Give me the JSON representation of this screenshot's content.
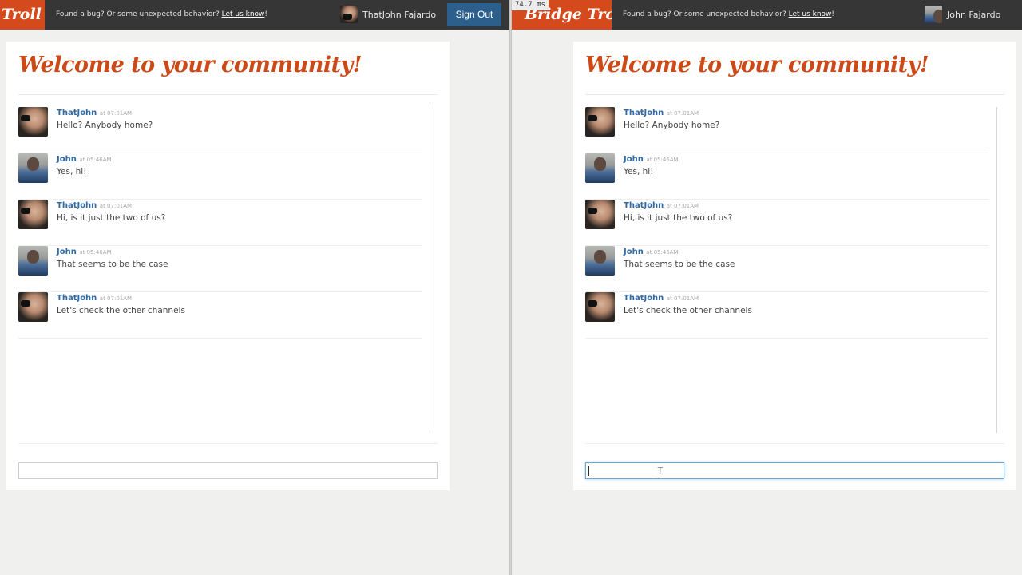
{
  "nav": {
    "logo_left": "Troll",
    "logo_right": "Bridge Troll",
    "bug_text": "Found a bug? Or some unexpected behavior? ",
    "bug_link": "Let us know",
    "bug_suffix": "!",
    "user_left": "ThatJohn Fajardo",
    "user_right": "John Fajardo",
    "signout_label": "Sign Out",
    "timing": "74.7 ms"
  },
  "page": {
    "heading": "Welcome to your community!"
  },
  "messages": [
    {
      "author": "ThatJohn",
      "meta": "at 07:01AM",
      "text": "Hello? Anybody home?",
      "avatar": "thatjohn-avatar"
    },
    {
      "author": "John",
      "meta": "at 05:46AM",
      "text": "Yes, hi!",
      "avatar": "john-avatar"
    },
    {
      "author": "ThatJohn",
      "meta": "at 07:01AM",
      "text": "Hi, is it just the two of us?",
      "avatar": "thatjohn-avatar"
    },
    {
      "author": "John",
      "meta": "at 05:46AM",
      "text": "That seems to be the case",
      "avatar": "john-avatar"
    },
    {
      "author": "ThatJohn",
      "meta": "at 07:01AM",
      "text": "Let's check the other channels",
      "avatar": "thatjohn-avatar"
    }
  ],
  "colors": {
    "brand": "#d44a1c",
    "heading": "#cc4a18",
    "author_link": "#2f6aa6",
    "signout": "#2c5f8c",
    "navbar": "#363636"
  }
}
